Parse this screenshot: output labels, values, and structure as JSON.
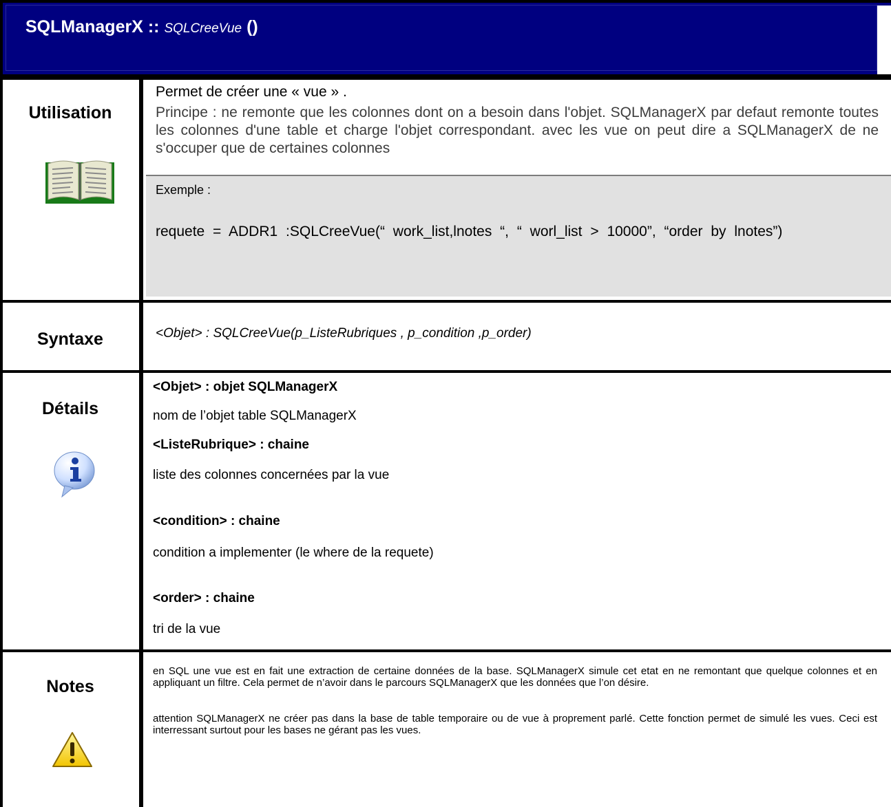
{
  "header": {
    "class_name": "SQLManagerX ::",
    "method_name": "SQLCreeVue",
    "parens": "()",
    "bg_color": "#000080"
  },
  "utilisation": {
    "label": "Utilisation",
    "icon": "book-icon",
    "line1": "Permet de créer une « vue » .",
    "principle": "Principe : ne remonte que les colonnes dont on a besoin dans l'objet. SQLManagerX par defaut remonte toutes les colonnes d'une table et charge l'objet correspondant. avec les vue on peut dire a SQLManagerX de ne s'occuper que de certaines colonnes",
    "example_title": "Exemple :",
    "example_code": "requete = ADDR1 :SQLCreeVue(“ work_list,lnotes “, “ worl_list > 10000”, “order by lnotes”)"
  },
  "syntaxe": {
    "label": "Syntaxe",
    "text": "<Objet> : SQLCreeVue(p_ListeRubriques , p_condition ,p_order)"
  },
  "details": {
    "label": "Détails",
    "icon": "info-icon",
    "params": [
      {
        "name": "<Objet> : objet SQLManagerX",
        "desc": "nom de l’objet table SQLManagerX"
      },
      {
        "name": "<ListeRubrique> : chaine",
        "desc": "liste des colonnes concernées par la vue"
      },
      {
        "name": "<condition> : chaine",
        "desc": "condition a implementer (le where de la requete)"
      },
      {
        "name": "<order> : chaine",
        "desc": "tri de la vue"
      }
    ]
  },
  "notes": {
    "label": "Notes",
    "icon": "warning-icon",
    "para1": "en SQL une vue est en fait une extraction de certaine données de la base. SQLManagerX simule cet etat en ne remontant que quelque colonnes et en appliquant un filtre. Cela permet de n’avoir dans le parcours SQLManagerX que les données que l’on désire.",
    "para2": "attention SQLManagerX ne créer pas dans la base de table temporaire ou de vue à proprement parlé. Cette fonction permet de simulé les vues. Ceci est interressant surtout pour les bases ne gérant pas les vues."
  }
}
